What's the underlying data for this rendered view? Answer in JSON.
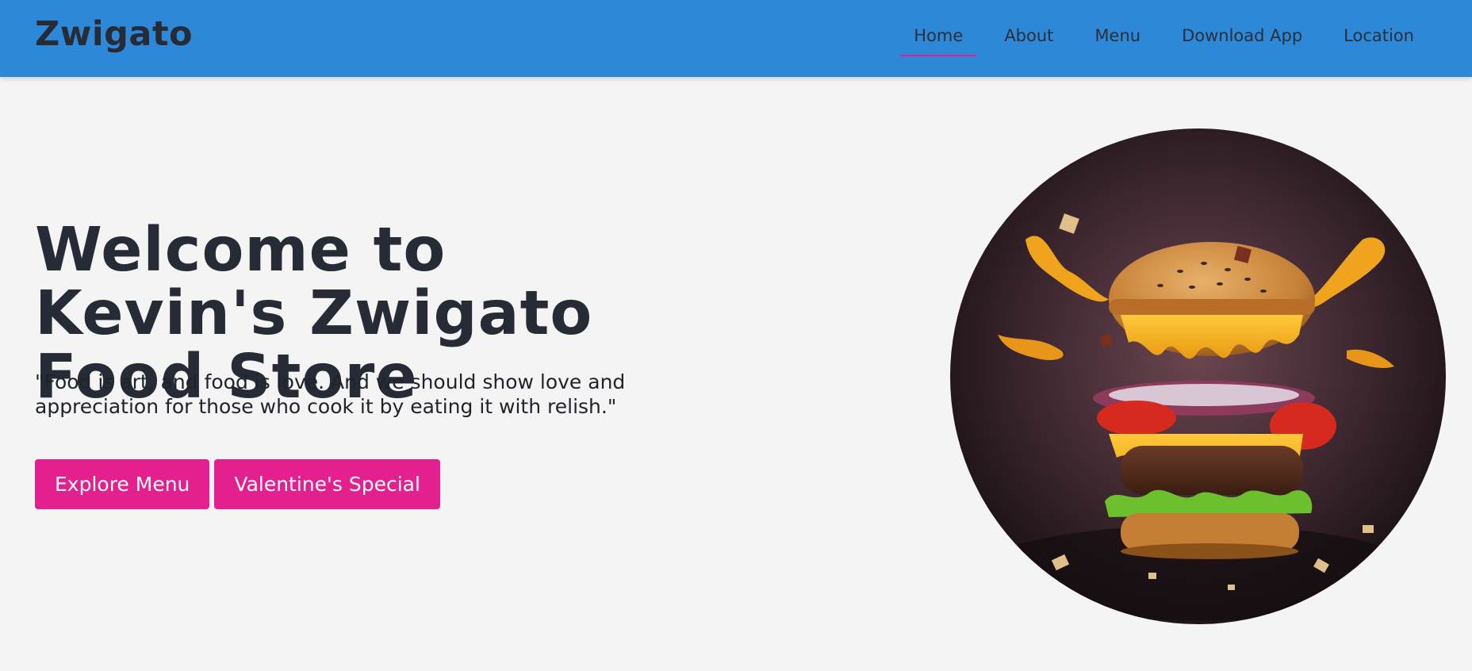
{
  "header": {
    "brand": "Zwigato",
    "nav": [
      {
        "label": "Home",
        "active": true
      },
      {
        "label": "About",
        "active": false
      },
      {
        "label": "Menu",
        "active": false
      },
      {
        "label": "Download App",
        "active": false
      },
      {
        "label": "Location",
        "active": false
      }
    ]
  },
  "hero": {
    "title": "Welcome to Kevin's Zwigato Food Store",
    "quote": "\"Food is art, and food is love. And we should show love and appreciation for those who cook it by eating it with relish.\"",
    "buttons": {
      "explore": "Explore Menu",
      "valentine": "Valentine's Special"
    },
    "image_subject": "exploding-cheeseburger"
  },
  "colors": {
    "navbar": "#2e88d8",
    "accent": "#e4208f",
    "background": "#f4f4f4",
    "text": "#262b35"
  }
}
